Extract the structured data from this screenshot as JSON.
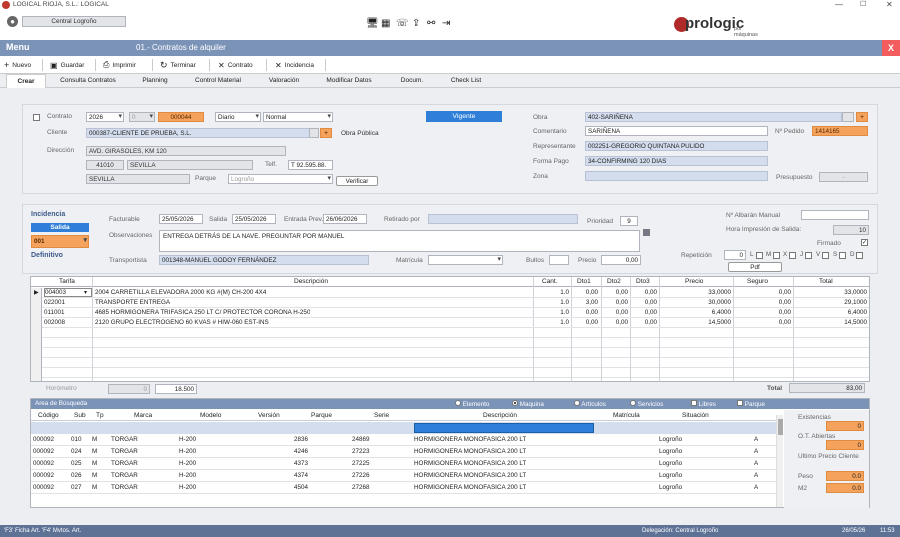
{
  "window": {
    "title": "LOGICAL RIOJA, S.L.: LOGICAL"
  },
  "header": {
    "user": "Central Logroño",
    "brand": "prologic",
    "brand_sub": "por máquinas"
  },
  "menubar": {
    "menu": "Menu",
    "doc_title": "01.- Contratos de alquiler",
    "close": "X"
  },
  "toolbar": {
    "nuevo": "Nuevo",
    "guardar": "Guardar",
    "imprimir": "Imprimir",
    "terminar": "Terminar",
    "contrato": "Contrato",
    "incidencia": "Incidencia"
  },
  "tabs": [
    "Crear",
    "Consulta Contratos",
    "Planning",
    "Control Material",
    "Valoración",
    "Modificar Datos",
    "Docum.",
    "Check List"
  ],
  "form": {
    "contrato_label": "Contrato",
    "year": "2026",
    "serie": "0",
    "numero": "000044",
    "periodo": "Diario",
    "tipo": "Normal",
    "estado": "Vigente",
    "cliente_label": "Cliente",
    "cliente": "000387-CLIENTE DE PRUEBA, S.L.",
    "obra_publica": "Obra Pública",
    "direccion_label": "Dirección",
    "direccion": "AVD. GIRASOLES, KM 120",
    "cp": "41010",
    "poblacion": "SEVILLA",
    "telf_label": "Telf.",
    "telf": "T 92.595.88.",
    "provincia": "SEVILLA",
    "parque_label": "Parque",
    "parque": "Logroño",
    "verificar": "Verificar",
    "obra_label": "Obra",
    "obra": "402-SARIÑENA",
    "comentario_label": "Comentario",
    "comentario": "SARIÑENA",
    "nf_pedido_label": "Nº Pedido",
    "nf_pedido": "1414165",
    "representante_label": "Representante",
    "representante": "002251-GREGORIO QUINTANA PULIDO",
    "forma_pago_label": "Forma Pago",
    "forma_pago": "34-CONFIRMING 120 DIAS",
    "zona_label": "Zona",
    "presupuesto_label": "Presupuesto",
    "presupuesto": "-"
  },
  "incidencia": {
    "title": "Incidencia",
    "salida": "Salida",
    "codigo": "001",
    "definitivo": "Definitivo",
    "facturable_label": "Facturable",
    "facturable": "25/05/2026",
    "salida_label": "Salida",
    "salida_date": "25/05/2026",
    "entrada_label": "Entrada Prev.",
    "entrada": "26/06/2026",
    "retirado_label": "Retirado por",
    "prioridad_label": "Prioridad",
    "prioridad": "9",
    "albaran_label": "Nº Albarán Manual",
    "hora_label": "Hora Impresión de Salida:",
    "hora": "10",
    "firmado_label": "Firmado",
    "observaciones_label": "Observaciones",
    "observaciones": "ENTREGA DETRÁS DE LA NAVE. PREGUNTAR POR MANUEL",
    "transportista_label": "Transportista",
    "transportista": "001348-MANUEL GODOY FERNÁNDEZ",
    "matricula_label": "Matrícula",
    "bultos_label": "Bultos",
    "precio_label": "Precio",
    "precio": "0,00",
    "repeticion_label": "Repetición",
    "repeticion": "0",
    "days": [
      "L",
      "M",
      "X",
      "J",
      "V",
      "S",
      "D"
    ],
    "pdf": "Pdf"
  },
  "lines": {
    "headers": [
      "Tarifa",
      "Descripción",
      "Cant.",
      "Dto1",
      "Dto2",
      "Dto3",
      "Precio",
      "Seguro",
      "Total"
    ],
    "rows": [
      [
        "004003",
        "2004 CARRETILLA ELEVADORA 2000 KG #(M) CH-200 4X4",
        "1.0",
        "0,00",
        "0,00",
        "0,00",
        "33,0000",
        "0,00",
        "33,0000"
      ],
      [
        "022001",
        "TRANSPORTE ENTREGA",
        "1.0",
        "3,00",
        "0,00",
        "0,00",
        "30,0000",
        "0,00",
        "29,1000"
      ],
      [
        "011001",
        "4685 HORMIGONERA TRIFASICA 250 LT C/ PROTECTOR CORONA H-250",
        "1.0",
        "0,00",
        "0,00",
        "0,00",
        "6,4000",
        "0,00",
        "6,4000"
      ],
      [
        "002008",
        "2120 GRUPO ELECTROGENO 60 KVAS # HIW-060 EST-INS",
        "1.0",
        "0,00",
        "0,00",
        "0,00",
        "14,5000",
        "0,00",
        "14,5000"
      ]
    ],
    "horometro_label": "Horómetro",
    "horometro_a": "0",
    "horometro_b": "18.500",
    "total_label": "Total",
    "total": "83,00"
  },
  "search": {
    "title": "Area de Búsqueda",
    "options": [
      "Elemento",
      "Maquina",
      "Artículos",
      "Servicios"
    ],
    "checks": [
      "Libres",
      "Parque"
    ],
    "headers": [
      "Código",
      "Sub",
      "Tp",
      "Marca",
      "Modelo",
      "Versión",
      "Parque",
      "Serie",
      "Descripción",
      "Matrícula",
      "Situación"
    ],
    "rows": [
      [
        "000092",
        "010",
        "M",
        "TORGAR",
        "H-200",
        "",
        "2836",
        "24869",
        "HORMIGONERA MONOFASICA 200 LT",
        "",
        "Logroño",
        "A"
      ],
      [
        "000092",
        "024",
        "M",
        "TORGAR",
        "H-200",
        "",
        "4246",
        "27223",
        "HORMIGONERA MONOFASICA 200 LT",
        "",
        "Logroño",
        "A"
      ],
      [
        "000092",
        "025",
        "M",
        "TORGAR",
        "H-200",
        "",
        "4373",
        "27225",
        "HORMIGONERA MONOFASICA 200 LT",
        "",
        "Logroño",
        "A"
      ],
      [
        "000092",
        "026",
        "M",
        "TORGAR",
        "H-200",
        "",
        "4374",
        "27226",
        "HORMIGONERA MONOFASICA 200 LT",
        "",
        "Logroño",
        "A"
      ],
      [
        "000092",
        "027",
        "M",
        "TORGAR",
        "H-200",
        "",
        "4504",
        "27268",
        "HORMIGONERA MONOFASICA 200 LT",
        "",
        "Logroño",
        "A"
      ]
    ],
    "existencias_label": "Existencias",
    "existencias": "0",
    "ot_label": "O.T. Abiertas",
    "ot": "0",
    "ultimo_label": "Ultimo Precio Cliente",
    "peso_label": "Peso",
    "peso": "0.0",
    "m2_label": "M2",
    "m2": "0.0"
  },
  "status": {
    "left": "'F3' Ficha Art. 'F4' Mvtos. Art.",
    "delegacion": "Delegación: Central Logroño",
    "date": "26/05/26",
    "time": "11:53"
  },
  "colors": {
    "accent": "#7c93b8",
    "orange": "#f5a35c",
    "close": "#f25c5c",
    "status_blue": "#2f7fd8"
  }
}
